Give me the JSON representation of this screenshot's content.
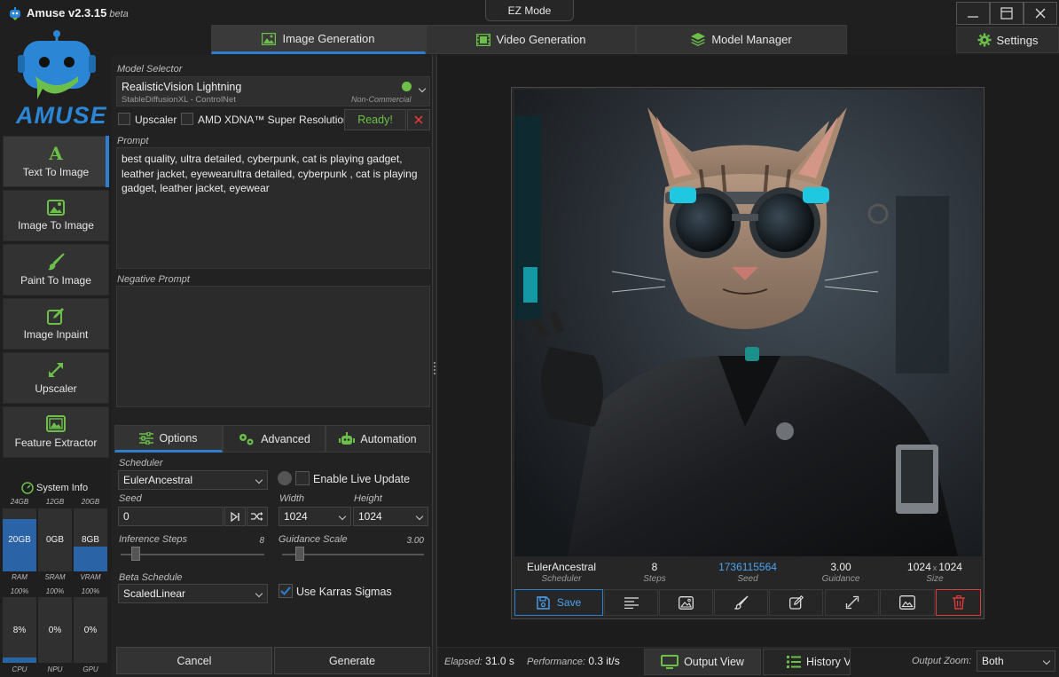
{
  "app": {
    "name": "Amuse v2.3.15",
    "beta": "beta",
    "logo_text": "AMUSE"
  },
  "ez_mode": "EZ Mode",
  "window": {
    "minimize": "—",
    "maximize": "☐",
    "close": "✕"
  },
  "settings_label": "Settings",
  "tabs": [
    {
      "label": "Image Generation",
      "icon": "image-icon",
      "active": true
    },
    {
      "label": "Video Generation",
      "icon": "film-icon",
      "active": false
    },
    {
      "label": "Model Manager",
      "icon": "layers-icon",
      "active": false
    }
  ],
  "nav": [
    {
      "label": "Text To Image",
      "icon": "letter-a-icon",
      "active": true
    },
    {
      "label": "Image To Image",
      "icon": "picture-icon",
      "active": false
    },
    {
      "label": "Paint To Image",
      "icon": "brush-icon",
      "active": false
    },
    {
      "label": "Image Inpaint",
      "icon": "edit-icon",
      "active": false
    },
    {
      "label": "Upscaler",
      "icon": "expand-icon",
      "active": false
    },
    {
      "label": "Feature Extractor",
      "icon": "gallery-icon",
      "active": false
    }
  ],
  "system_info": {
    "title": "System Info",
    "memory": [
      {
        "cap_top": "24GB",
        "value": "20GB",
        "cap_bottom": "RAM",
        "fraction": 0.83
      },
      {
        "cap_top": "12GB",
        "value": "0GB",
        "cap_bottom": "SRAM",
        "fraction": 0
      },
      {
        "cap_top": "20GB",
        "value": "8GB",
        "cap_bottom": "VRAM",
        "fraction": 0.4
      }
    ],
    "usage": [
      {
        "cap_top": "100%",
        "value": "8%",
        "cap_bottom": "CPU",
        "fraction": 0.08
      },
      {
        "cap_top": "100%",
        "value": "0%",
        "cap_bottom": "NPU",
        "fraction": 0
      },
      {
        "cap_top": "100%",
        "value": "0%",
        "cap_bottom": "GPU",
        "fraction": 0
      }
    ]
  },
  "model": {
    "label": "Model Selector",
    "name": "RealisticVision Lightning",
    "sub": "StableDiffusionXL - ControlNet",
    "license": "Non-Commercial",
    "status_color": "#6cc04a"
  },
  "upscaler": {
    "label": "Upscaler",
    "checked": false
  },
  "amd_sr": {
    "label": "AMD XDNA™ Super Resolution",
    "checked": false
  },
  "ready_label": "Ready!",
  "prompt": {
    "label": "Prompt",
    "text": "best quality, ultra detailed, cyberpunk, cat is playing gadget, leather jacket, eyewearultra detailed, cyberpunk , cat is playing gadget, leather jacket, eyewear"
  },
  "negative_prompt": {
    "label": "Negative Prompt",
    "text": ""
  },
  "subtabs": [
    {
      "label": "Options",
      "icon": "sliders-icon",
      "active": true
    },
    {
      "label": "Advanced",
      "icon": "gears-icon",
      "active": false
    },
    {
      "label": "Automation",
      "icon": "robot-icon",
      "active": false
    }
  ],
  "options": {
    "scheduler_label": "Scheduler",
    "scheduler": "EulerAncestral",
    "live_update_label": "Enable Live Update",
    "seed_label": "Seed",
    "seed": "0",
    "width_label": "Width",
    "width": "1024",
    "height_label": "Height",
    "height": "1024",
    "steps_label": "Inference Steps",
    "steps": "8",
    "steps_fraction": 0.08,
    "guidance_label": "Guidance Scale",
    "guidance": "3.00",
    "guidance_fraction": 0.1,
    "beta_label": "Beta Schedule",
    "beta": "ScaledLinear",
    "karras_label": "Use Karras Sigmas",
    "karras_checked": true
  },
  "cancel_label": "Cancel",
  "generate_label": "Generate",
  "result": {
    "scheduler": "EulerAncestral",
    "scheduler_cap": "Scheduler",
    "steps": "8",
    "steps_cap": "Steps",
    "seed": "1736115564",
    "seed_cap": "Seed",
    "guidance": "3.00",
    "guidance_cap": "Guidance",
    "size_w": "1024",
    "size_x": "x",
    "size_h": "1024",
    "size_cap": "Size"
  },
  "save_label": "Save",
  "status": {
    "elapsed_label": "Elapsed:",
    "elapsed": "31.0 s",
    "performance_label": "Performance:",
    "performance": "0.3 it/s",
    "output_view": "Output View",
    "history_view": "History Vi",
    "zoom_label": "Output Zoom:",
    "zoom": "Both"
  },
  "colors": {
    "accent": "#2f7fd0",
    "ready_green": "#6cc04a",
    "delete_red": "#e03a3a",
    "seed_blue": "#4aa3f0"
  }
}
